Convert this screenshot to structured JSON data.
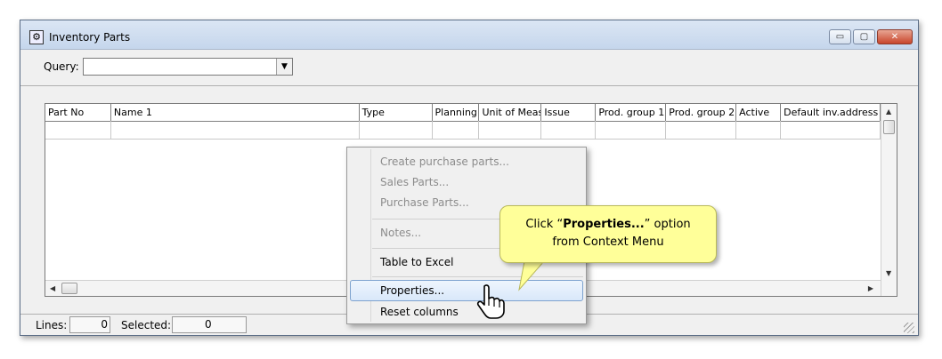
{
  "window": {
    "title": "Inventory Parts",
    "buttons": {
      "minimize": "▭",
      "maximize": "▢",
      "close": "✕"
    }
  },
  "query": {
    "label": "Query:",
    "value": ""
  },
  "table": {
    "columns": [
      "Part No",
      "Name 1",
      "Type",
      "Planning",
      "Unit of Meas",
      "Issue",
      "Prod. group 1",
      "Prod. group 2",
      "Active",
      "Default inv.address"
    ]
  },
  "status": {
    "lines_label": "Lines:",
    "lines_value": "0",
    "selected_label": "Selected:",
    "selected_value": "0"
  },
  "context_menu": {
    "items": [
      {
        "label": "Create purchase parts...",
        "enabled": false
      },
      {
        "label": "Sales Parts...",
        "enabled": false
      },
      {
        "label": "Purchase Parts...",
        "enabled": false
      },
      {
        "label": "Notes...",
        "enabled": false
      },
      {
        "label": "Table to Excel",
        "enabled": true
      },
      {
        "label": "Properties...",
        "enabled": true,
        "highlighted": true
      },
      {
        "label": "Reset columns",
        "enabled": true
      }
    ]
  },
  "callout": {
    "prefix": "Click “",
    "bold": "Properties...",
    "suffix": "” option",
    "line2": "from Context Menu"
  },
  "icons": [
    "app-icon",
    "dropdown-arrow-icon",
    "scroll-up-icon",
    "scroll-down-icon",
    "scroll-left-icon",
    "scroll-right-icon",
    "hand-pointer-icon",
    "resize-grip-icon"
  ],
  "colors": {
    "callout_bg": "#ffff99",
    "highlight_border": "#7da2ce",
    "close_button": "#c8452b"
  }
}
